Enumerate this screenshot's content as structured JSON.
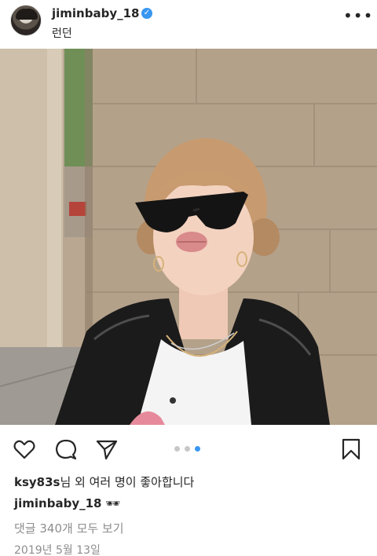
{
  "post_header": {
    "username": "jiminbaby_18",
    "verified_mark": "✓",
    "location": "런던",
    "avatar_icon": "profile-avatar",
    "more_icon": "more-options-icon",
    "more_glyph": "•••"
  },
  "photo": {
    "carousel_total": 3,
    "carousel_active": 3
  },
  "actions": {
    "icons": [
      "heart-icon",
      "comment-bubble-icon",
      "paper-plane-icon",
      "bookmark-icon"
    ]
  },
  "likes": {
    "user": "ksy83s",
    "text": "님 외 여러 명이 좋아합니다"
  },
  "caption": {
    "user": "jiminbaby_18",
    "emoji": "🕶"
  },
  "comments": {
    "label": "댓글 340개 모두 보기"
  },
  "timestamp": "2019년 5월 13일",
  "colors": {
    "accent": "#3897f0",
    "muted": "#8e8e8e",
    "text": "#262626"
  }
}
